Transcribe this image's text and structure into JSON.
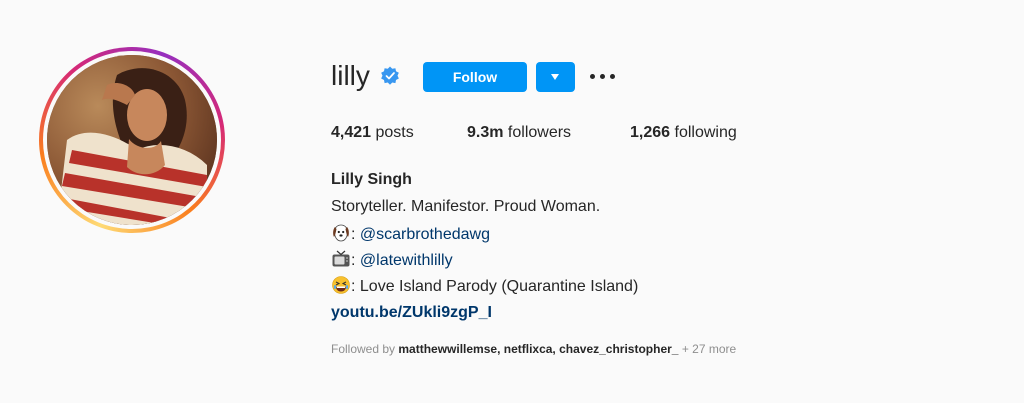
{
  "profile": {
    "username": "lilly",
    "verified": true,
    "follow_label": "Follow",
    "stats": {
      "posts_count": "4,421",
      "posts_label": "posts",
      "followers_count": "9.3m",
      "followers_label": "followers",
      "following_count": "1,266",
      "following_label": "following"
    },
    "bio": {
      "full_name": "Lilly Singh",
      "tagline": "Storyteller. Manifestor. Proud Woman.",
      "lines": [
        {
          "icon": "dog-face-icon",
          "sep": ": ",
          "text": "@scarbrothedawg"
        },
        {
          "icon": "television-icon",
          "sep": ": ",
          "text": "@latewithlilly"
        },
        {
          "icon": "laughing-face-icon",
          "sep": ": ",
          "text": "Love Island Parody (Quarantine Island)"
        }
      ],
      "link": "youtu.be/ZUkli9zgP_I"
    },
    "followed_by": {
      "prefix": "Followed by ",
      "names": "matthewwillemse, netflixca, chavez_christopher_",
      "more": " + 27 more"
    }
  },
  "colors": {
    "follow_blue": "#0095f6",
    "link_blue": "#00376b",
    "muted_gray": "#8e8e8e",
    "verified_blue": "#3897f0"
  }
}
